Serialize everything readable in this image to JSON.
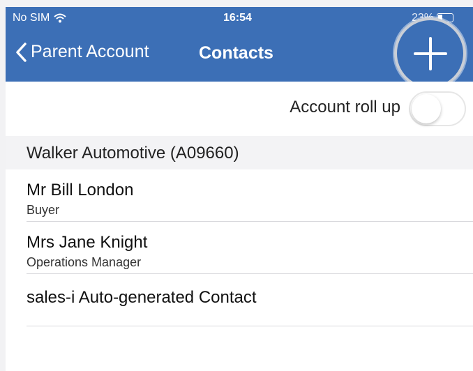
{
  "status_bar": {
    "carrier": "No SIM",
    "time": "16:54",
    "battery": "23%"
  },
  "nav": {
    "back_label": "Parent Account",
    "title": "Contacts"
  },
  "rollup": {
    "label": "Account roll up",
    "enabled": false
  },
  "section": {
    "title": "Walker Automotive (A09660)"
  },
  "contacts": [
    {
      "name": "Mr Bill London",
      "role": "Buyer"
    },
    {
      "name": "Mrs Jane Knight",
      "role": "Operations Manager"
    },
    {
      "name": "sales-i Auto-generated Contact",
      "role": ""
    },
    {
      "name": "",
      "role": ""
    }
  ],
  "colors": {
    "nav_bar": "#3c6fb6",
    "section_header": "#f3f3f5",
    "separator": "#d8d8dc"
  },
  "icons": {
    "back": "chevron-left-icon",
    "add": "plus-icon",
    "wifi": "wifi-icon",
    "battery": "battery-icon"
  }
}
